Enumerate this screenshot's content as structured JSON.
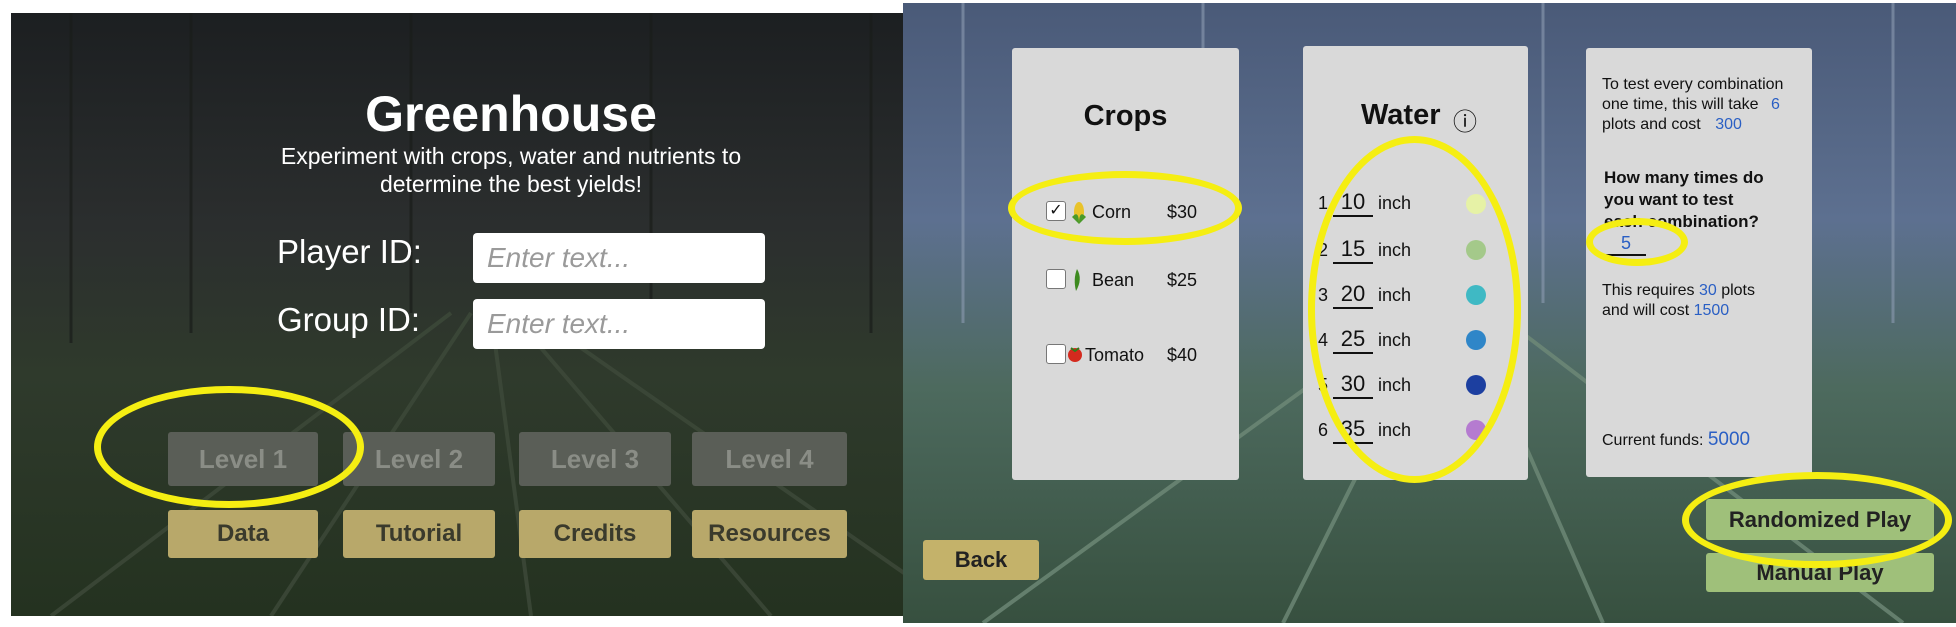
{
  "menu": {
    "title": "Greenhouse",
    "subtitle_line1": "Experiment with crops, water and nutrients to",
    "subtitle_line2": "determine the best yields!",
    "player_id_label": "Player ID:",
    "player_id_placeholder": "Enter text...",
    "group_id_label": "Group ID:",
    "group_id_placeholder": "Enter text...",
    "levels": [
      "Level 1",
      "Level 2",
      "Level 3",
      "Level 4"
    ],
    "buttons": [
      "Data",
      "Tutorial",
      "Credits",
      "Resources"
    ]
  },
  "setup": {
    "crops": {
      "title": "Crops",
      "items": [
        {
          "name": "Corn",
          "price": "$30",
          "checked": true,
          "icon": "corn-icon",
          "checkmark": "✓"
        },
        {
          "name": "Bean",
          "price": "$25",
          "checked": false,
          "icon": "bean-icon",
          "checkmark": ""
        },
        {
          "name": "Tomato",
          "price": "$40",
          "checked": false,
          "icon": "tomato-icon",
          "checkmark": ""
        }
      ]
    },
    "water": {
      "title": "Water",
      "info_icon": "ⓘ",
      "rows": [
        {
          "index": "1",
          "amount": "10",
          "unit": "inch",
          "color": "#e6f2a6"
        },
        {
          "index": "2",
          "amount": "15",
          "unit": "inch",
          "color": "#a4c98a"
        },
        {
          "index": "3",
          "amount": "20",
          "unit": "inch",
          "color": "#3fb9c4"
        },
        {
          "index": "4",
          "amount": "25",
          "unit": "inch",
          "color": "#2f86c8"
        },
        {
          "index": "5",
          "amount": "30",
          "unit": "inch",
          "color": "#1c3fa0"
        },
        {
          "index": "6",
          "amount": "35",
          "unit": "inch",
          "color": "#b57bd0"
        }
      ]
    },
    "summary": {
      "combo_line1": "To test every combination",
      "combo_line2": "one time, this will take",
      "combo_plots": "6",
      "combo_line3": "plots and cost",
      "combo_cost": "300",
      "question_line1": "How many times do",
      "question_line2": "you  want to test",
      "question_line3": "each combination?",
      "times_value": "5",
      "requires_prefix": "This requires",
      "requires_plots": "30",
      "requires_plots_suffix": "plots",
      "cost_prefix": "and will cost",
      "cost_value": "1500",
      "funds_label": "Current funds:",
      "funds_value": "5000"
    },
    "back_label": "Back",
    "randomized_label": "Randomized Play",
    "manual_label": "Manual Play"
  },
  "colors": {
    "highlight_ring": "#f5ee12",
    "card_bg": "#d9d9d9",
    "accent_blue": "#2a5fc4",
    "menu_button": "#b8a86a",
    "play_button": "#9fc07a"
  }
}
